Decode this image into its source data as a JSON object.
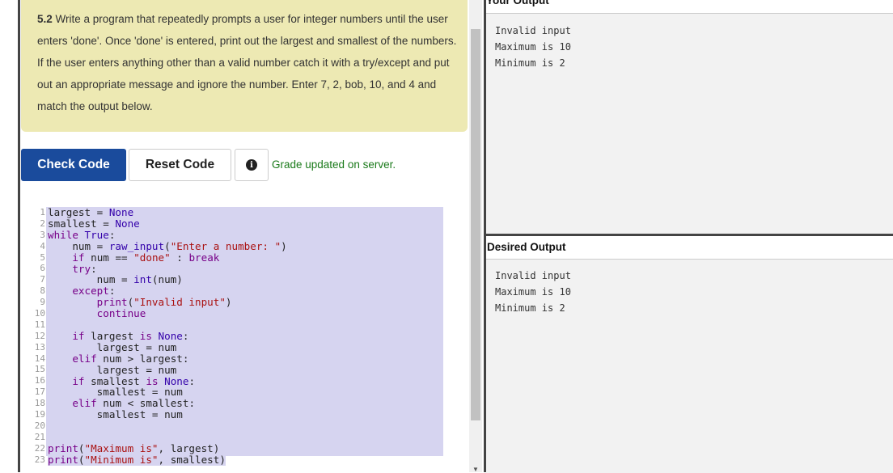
{
  "prompt": {
    "number": "5.2",
    "text": " Write a program that repeatedly prompts a user for integer numbers until the user enters 'done'. Once 'done' is entered, print out the largest and smallest of the numbers. If the user enters anything other than a valid number catch it with a try/except and put out an appropriate message and ignore the number. Enter 7, 2, bob, 10, and 4 and match the output below."
  },
  "buttons": {
    "check": "Check Code",
    "reset": "Reset Code",
    "info_icon": "info-icon"
  },
  "status": "Grade updated on server.",
  "editor": {
    "line_numbers": [
      "1",
      "2",
      "3",
      "4",
      "5",
      "6",
      "7",
      "8",
      "9",
      "10",
      "11",
      "12",
      "13",
      "14",
      "15",
      "16",
      "17",
      "18",
      "19",
      "20",
      "21",
      "22",
      "23"
    ],
    "lines": [
      "largest = None",
      "smallest = None",
      "while True:",
      "    num = raw_input(\"Enter a number: \")",
      "    if num == \"done\" : break",
      "    try:",
      "        num = int(num)",
      "    except:",
      "        print(\"Invalid input\")",
      "        continue",
      "",
      "    if largest is None:",
      "        largest = num",
      "    elif num > largest:",
      "        largest = num",
      "    if smallest is None:",
      "        smallest = num",
      "    elif num < smallest:",
      "        smallest = num",
      "",
      "",
      "print(\"Maximum is\", largest)",
      "print(\"Minimum is\", smallest)"
    ]
  },
  "your_output": {
    "title": "Your Output",
    "lines": [
      "Invalid input",
      "Maximum is 10",
      "Minimum is 2"
    ]
  },
  "desired_output": {
    "title": "Desired Output",
    "lines": [
      "Invalid input",
      "Maximum is 10",
      "Minimum is 2"
    ]
  }
}
